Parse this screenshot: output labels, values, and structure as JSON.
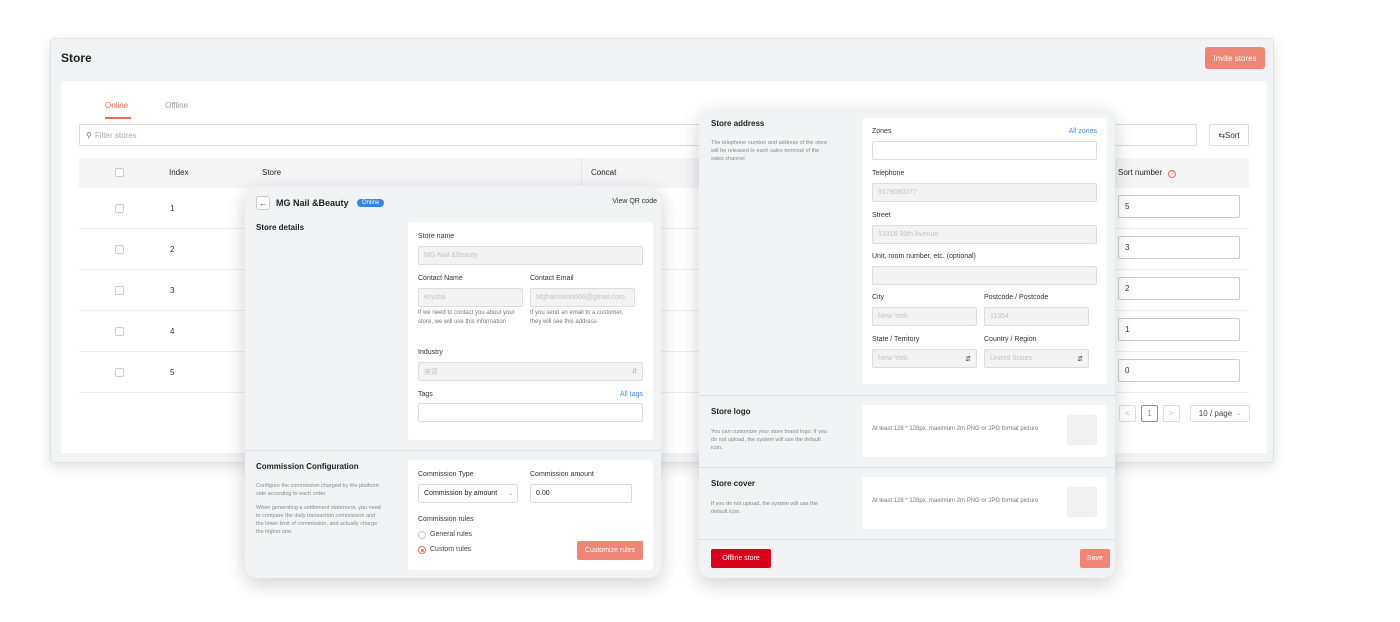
{
  "store": {
    "title": "Store",
    "invite_label": "Invite stores",
    "tabs": [
      {
        "label": "Online"
      },
      {
        "label": "Offline"
      }
    ],
    "filter_placeholder": "Filter stores",
    "sort_label": "Sort",
    "columns": {
      "index": "Index",
      "store": "Store",
      "concat": "Concat",
      "sort_number": "Sort number"
    },
    "rows": [
      {
        "index": "1",
        "sort": "5"
      },
      {
        "index": "2",
        "sort": "3"
      },
      {
        "index": "3",
        "sort": "2"
      },
      {
        "index": "4",
        "sort": "1"
      },
      {
        "index": "5",
        "sort": "0"
      }
    ],
    "pagination": {
      "prev": "<",
      "page": "1",
      "next": ">",
      "page_size": "10 / page"
    }
  },
  "store_detail": {
    "name": "MG Nail &Beauty",
    "status_badge": "Online",
    "view_qr": "View QR code",
    "details_heading": "Store details",
    "store_name_label": "Store name",
    "store_name_value": "MG Nail &Beauty",
    "contact_name_label": "Contact Name",
    "contact_name_value": "Krystal",
    "contact_name_hint": "If we need to contact you about your store, we will use this information",
    "contact_email_label": "Contact Email",
    "contact_email_value": "Mghairsalon666@gmail.com",
    "contact_email_hint": "If you send an email to a customer, they will see this address",
    "industry_label": "Industry",
    "industry_value": "美容",
    "tags_label": "Tags",
    "all_tags": "All tags",
    "commission_heading": "Commission Configuration",
    "commission_desc1": "Configure the commission charged by the platform side according to each order",
    "commission_desc2": "When generating a settlement statement, you need to compare the daily transaction commission and the lower limit of commission, and actually charge the higher one.",
    "commission_type_label": "Commission Type",
    "commission_type_value": "Commission by amount",
    "commission_amount_label": "Commission amount",
    "commission_amount_value": "0.00",
    "commission_rules_label": "Commission rules",
    "rule_general": "General rules",
    "rule_custom": "Custom rules",
    "customize_rules": "Customize rules"
  },
  "store_address": {
    "heading": "Store address",
    "desc": "The telephone number and address of the store will be released to each sales terminal of the sales channel",
    "zones_label": "Zones",
    "all_zones": "All zones",
    "telephone_label": "Telephone",
    "telephone_value": "9179080277",
    "street_label": "Street",
    "street_value": "13316 39th Avenue",
    "unit_label": "Unit, room number, etc. (optional)",
    "city_label": "City",
    "city_value": "New York",
    "postcode_label": "Postcode / Postcode",
    "postcode_value": "11354",
    "state_label": "State / Territory",
    "state_value": "New York",
    "country_label": "Country / Region",
    "country_value": "United States",
    "logo_heading": "Store logo",
    "logo_desc": "You can customize your store brand logo; If you do not upload, the system will use the default icon.",
    "logo_hint": "At least 128 * 128px, maximum 2m PNG or JPG format picture",
    "cover_heading": "Store cover",
    "cover_desc": "If you do not upload, the system will use the default icon.",
    "cover_hint": "At least 128 * 128px, maximum 2m PNG or JPG format picture",
    "offline_btn": "Offline store",
    "save_btn": "Save"
  },
  "colors": {
    "accent": "#ef6b5d",
    "button": "#ef8577",
    "danger": "#d9001b",
    "link": "#3f8ef0"
  }
}
